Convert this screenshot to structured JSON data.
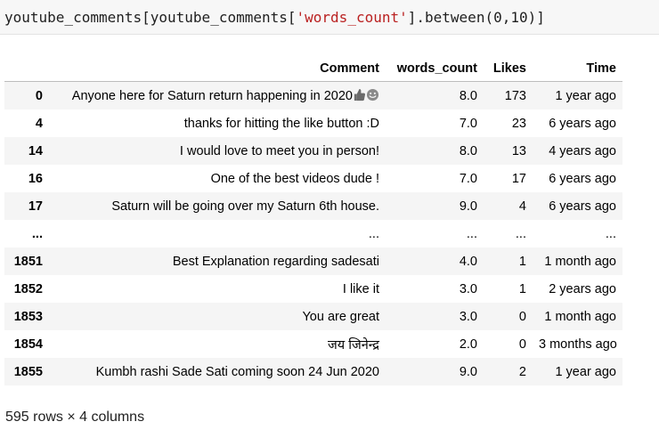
{
  "code": {
    "prefix": "youtube_comments[youtube_comments[",
    "string": "'words_count'",
    "suffix": "].between(0,10)]"
  },
  "table": {
    "columns": [
      "Comment",
      "words_count",
      "Likes",
      "Time"
    ],
    "rows": [
      {
        "index": "0",
        "comment": "Anyone here for Saturn return happening in 2020",
        "words_count": "8.0",
        "likes": "173",
        "time": "1 year ago"
      },
      {
        "index": "4",
        "comment": "thanks for hitting the like button :D",
        "words_count": "7.0",
        "likes": "23",
        "time": "6 years ago"
      },
      {
        "index": "14",
        "comment": "I would love to meet you in person!",
        "words_count": "8.0",
        "likes": "13",
        "time": "4 years ago"
      },
      {
        "index": "16",
        "comment": "One of the best videos dude !",
        "words_count": "7.0",
        "likes": "17",
        "time": "6 years ago"
      },
      {
        "index": "17",
        "comment": "Saturn will be going over my Saturn 6th house.",
        "words_count": "9.0",
        "likes": "4",
        "time": "6 years ago"
      },
      {
        "index": "...",
        "comment": "...",
        "words_count": "...",
        "likes": "...",
        "time": "..."
      },
      {
        "index": "1851",
        "comment": "Best Explanation regarding sadesati",
        "words_count": "4.0",
        "likes": "1",
        "time": "1 month ago"
      },
      {
        "index": "1852",
        "comment": "I like it",
        "words_count": "3.0",
        "likes": "1",
        "time": "2 years ago"
      },
      {
        "index": "1853",
        "comment": "You are great",
        "words_count": "3.0",
        "likes": "0",
        "time": "1 month ago"
      },
      {
        "index": "1854",
        "comment": "जय जिनेन्द्र",
        "words_count": "2.0",
        "likes": "0",
        "time": "3 months ago"
      },
      {
        "index": "1855",
        "comment": "Kumbh rashi Sade Sati coming soon 24 Jun 2020",
        "words_count": "9.0",
        "likes": "2",
        "time": "1 year ago"
      }
    ],
    "row0_emojis": [
      "thumbs-up-icon",
      "smiling-face-icon"
    ]
  },
  "footer": "595 rows × 4 columns"
}
